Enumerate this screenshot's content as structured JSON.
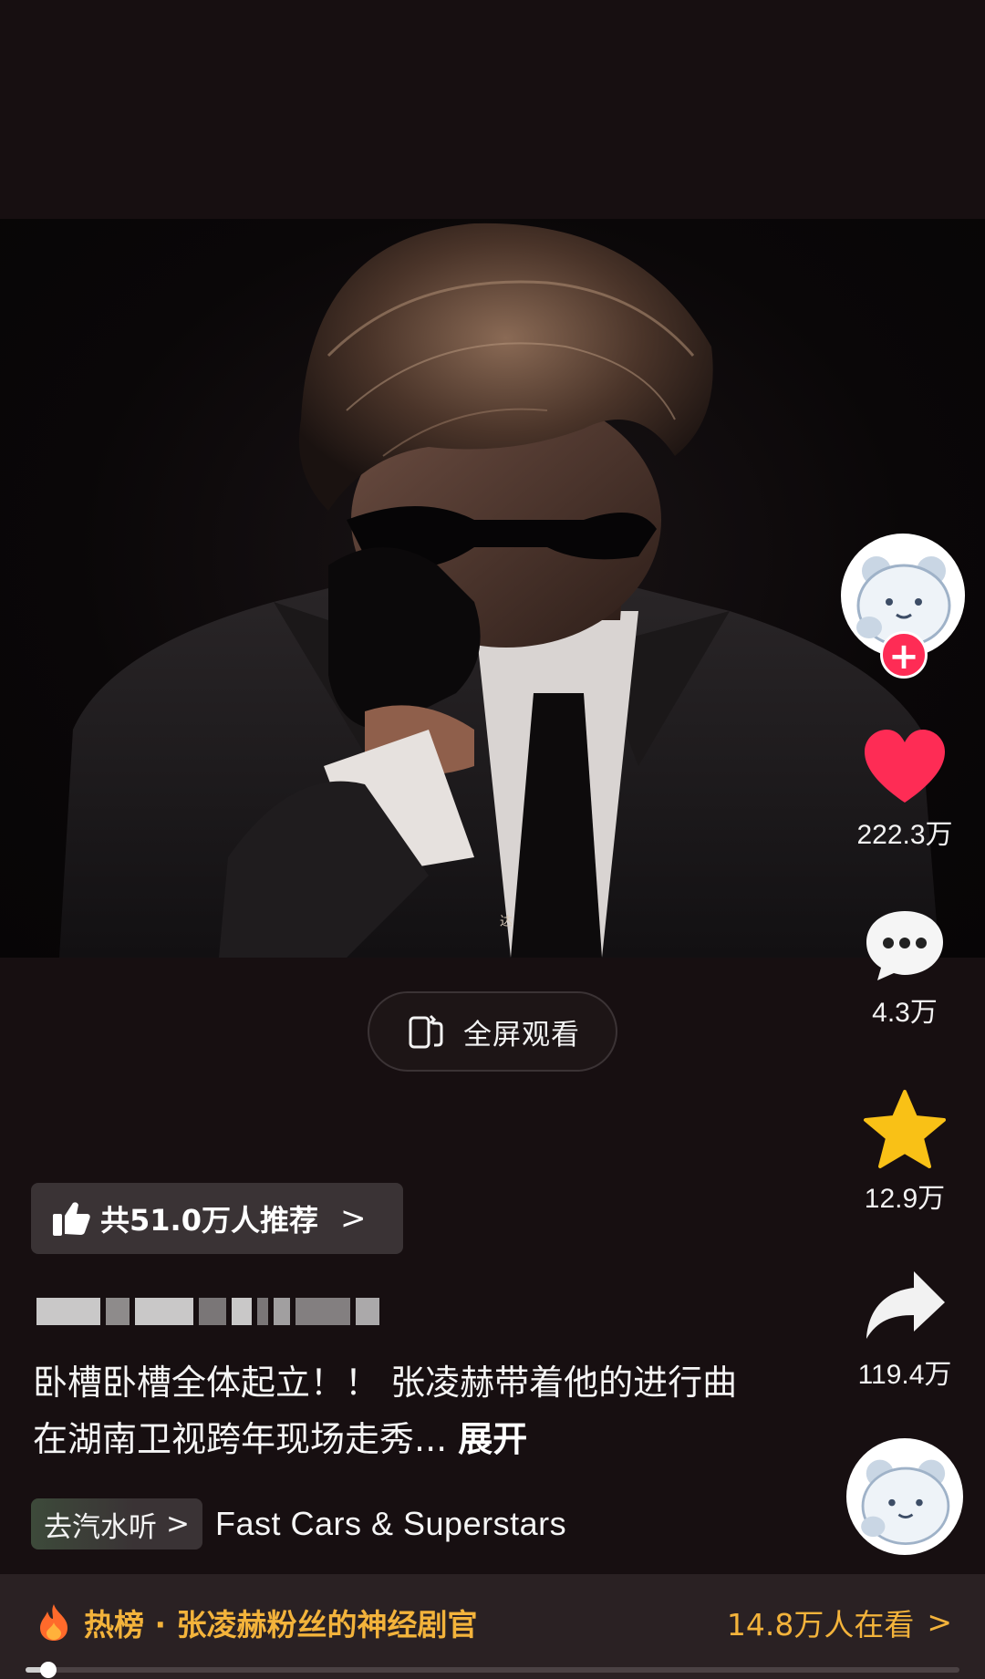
{
  "video": {
    "watermark_text": "达",
    "fullscreen_label": "全屏观看"
  },
  "rail": {
    "likes": "222.3万",
    "comments": "4.3万",
    "favorites": "12.9万",
    "shares": "119.4万",
    "follow_symbol": "+"
  },
  "recommend": {
    "label": "共51.0万人推荐",
    "chevron": ">"
  },
  "post": {
    "description": "卧槽卧槽全体起立！！ 张凌赫带着他的进行曲在湖南卫视跨年现场走秀...",
    "expand_label": "展开"
  },
  "music": {
    "tag_label": "去汽水听",
    "tag_chevron": ">",
    "title": "Fast Cars & Superstars"
  },
  "hot": {
    "label": "热榜 · 张凌赫粉丝的神经剧官",
    "watching": "14.8万人在看",
    "chevron": ">"
  },
  "playback": {
    "progress": 0.02
  },
  "colors": {
    "background": "#170f11",
    "like_red": "#fe2c55",
    "star_yellow": "#f9c116",
    "hot_accent": "#f3b33b"
  },
  "icons": {
    "like": "heart-icon",
    "comment": "comment-bubble-icon",
    "favorite": "star-icon",
    "share": "share-arrow-icon",
    "fullscreen": "rotate-phone-icon",
    "recommend": "thumbs-up-icon",
    "hot": "flame-icon"
  }
}
